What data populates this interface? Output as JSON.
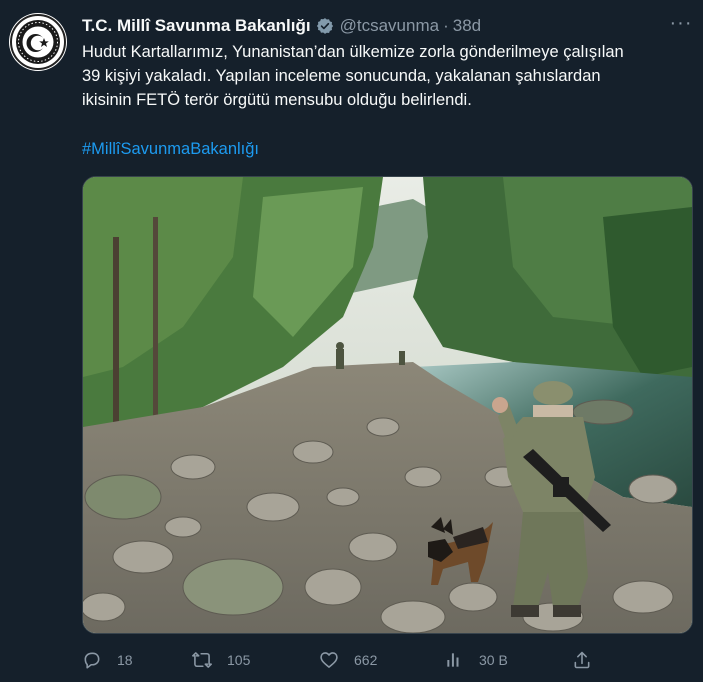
{
  "account": {
    "display_name": "T.C. Millî Savunma Bakanlığı",
    "handle": "@tcsavunma",
    "separator": "·",
    "timestamp": "38d",
    "verified_badge": "verified-badge-icon"
  },
  "tweet": {
    "lines": [
      "Hudut Kartallarımız, Yunanistan’dan ülkemize zorla gönderilmeye çalışılan",
      "39 kişiyi yakaladı. Yapılan inceleme sonucunda, yakalanan şahıslardan",
      "ikisinin FETÖ terör örgütü mensubu olduğu belirlendi."
    ],
    "hashtag": "#MillîSavunmaBakanlığı"
  },
  "actions": {
    "reply_count": "18",
    "retweet_count": "105",
    "like_count": "662",
    "view_count": "30 B"
  },
  "colors": {
    "background": "#15202b",
    "text": "#f7f9f9",
    "muted": "#8b98a5",
    "link": "#1d9bf0",
    "verified": "#829aab"
  }
}
